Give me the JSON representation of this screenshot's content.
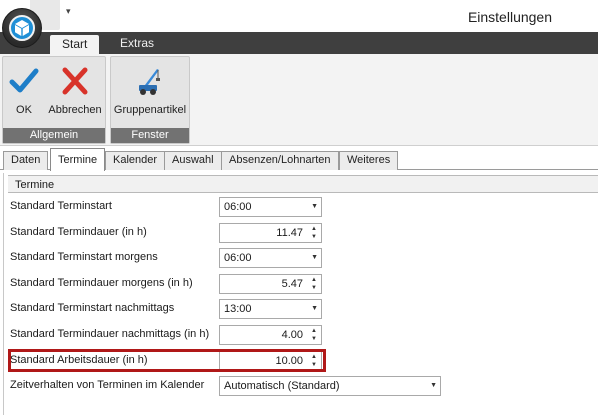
{
  "window": {
    "title": "Einstellungen"
  },
  "ribbon": {
    "tabs": [
      {
        "label": "Start"
      },
      {
        "label": "Extras"
      }
    ],
    "groups": [
      {
        "label": "Allgemein",
        "buttons": [
          {
            "label": "OK",
            "icon": "checkmark-icon"
          },
          {
            "label": "Abbrechen",
            "icon": "cross-icon"
          }
        ]
      },
      {
        "label": "Fenster",
        "buttons": [
          {
            "label": "Gruppenartikel",
            "icon": "crane-icon"
          }
        ]
      }
    ]
  },
  "page_tabs": [
    {
      "label": "Daten"
    },
    {
      "label": "Termine"
    },
    {
      "label": "Kalender"
    },
    {
      "label": "Auswahl"
    },
    {
      "label": "Absenzen/Lohnarten"
    },
    {
      "label": "Weiteres"
    }
  ],
  "section": {
    "title": "Termine"
  },
  "settings": [
    {
      "label": "Standard Terminstart",
      "value": "06:00",
      "control": "dropdown"
    },
    {
      "label": "Standard Termindauer (in h)",
      "value": "11.47",
      "control": "spinner"
    },
    {
      "label": "Standard Terminstart morgens",
      "value": "06:00",
      "control": "dropdown"
    },
    {
      "label": "Standard Termindauer morgens (in h)",
      "value": "5.47",
      "control": "spinner"
    },
    {
      "label": "Standard Terminstart nachmittags",
      "value": "13:00",
      "control": "dropdown"
    },
    {
      "label": "Standard Termindauer nachmittags (in h)",
      "value": "4.00",
      "control": "spinner"
    },
    {
      "label": "Standard Arbeitsdauer (in h)",
      "value": "10.00",
      "control": "spinner",
      "highlighted": true
    },
    {
      "label": "Zeitverhalten von Terminen im Kalender",
      "value": "Automatisch (Standard)",
      "control": "dropdown"
    }
  ],
  "colors": {
    "highlight": "#b01818",
    "orb": "#1f8fd6",
    "tab_bar": "#3f3f3f"
  }
}
